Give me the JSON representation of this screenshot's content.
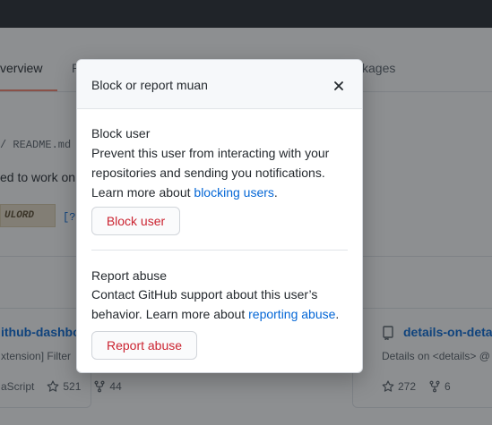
{
  "background": {
    "tabs": {
      "overview": "verview",
      "partial": "P",
      "packages": "kages"
    },
    "readme_path": "/ README.md",
    "readme_text": "ed to work on",
    "badge_text": "ULORD",
    "help_text": "[?]",
    "cards": [
      {
        "title": "ithub-dashbo",
        "description": "xtension] Filter",
        "language": "aScript",
        "stars": "521",
        "forks": "44"
      },
      {
        "title": "details-on-detai",
        "description": "Details on <details> @",
        "stars": "272",
        "forks": "6"
      }
    ]
  },
  "dialog": {
    "title": "Block or report muan",
    "block": {
      "heading": "Block user",
      "text": "Prevent this user from interacting with your repositories and sending you notifications. Learn more about ",
      "link": "blocking users",
      "suffix": ".",
      "button": "Block user"
    },
    "report": {
      "heading": "Report abuse",
      "text": "Contact GitHub support about this user’s behavior. Learn more about ",
      "link": "reporting abuse",
      "suffix": ".",
      "button": "Report abuse"
    }
  },
  "colors": {
    "danger": "#cb2431",
    "link": "#0366d6",
    "topbar": "#24292e",
    "tab_accent": "#f9826c"
  }
}
